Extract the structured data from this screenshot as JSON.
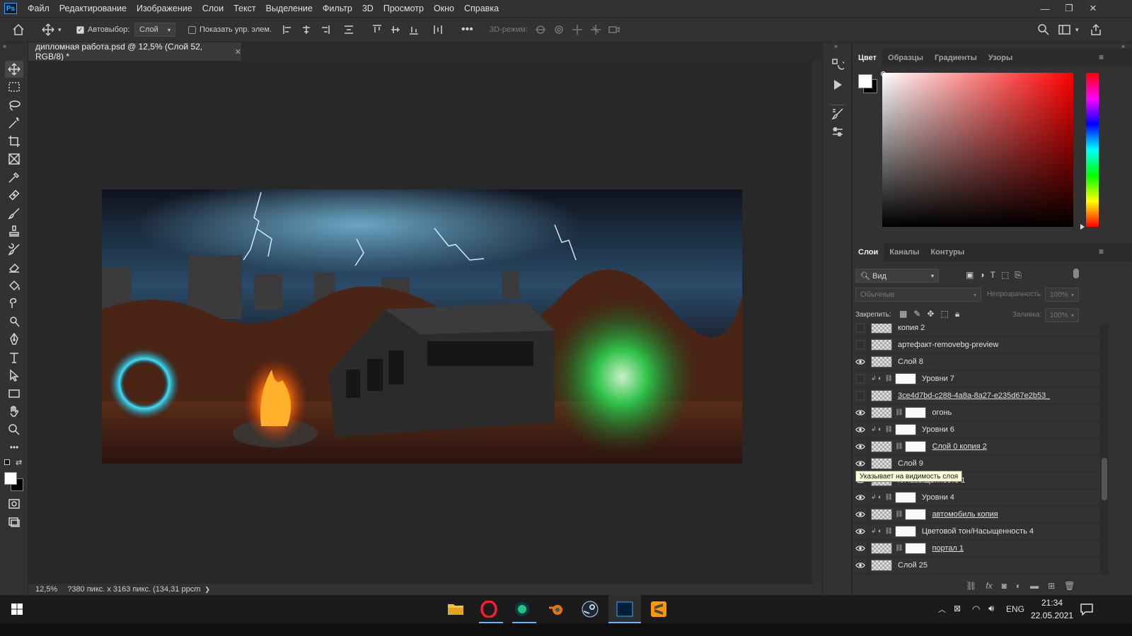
{
  "menubar": {
    "logo": "Ps",
    "items": [
      "Файл",
      "Редактирование",
      "Изображение",
      "Слои",
      "Текст",
      "Выделение",
      "Фильтр",
      "3D",
      "Просмотр",
      "Окно",
      "Справка"
    ]
  },
  "options": {
    "autoselect_label": "Автовыбор:",
    "autoselect_value": "Слой",
    "show_transform": "Показать упр. элем.",
    "mode3d": "3D-режим:"
  },
  "document": {
    "tab_title": "дипломная работа.psd @ 12,5% (Слой 52, RGB/8) *"
  },
  "status": {
    "zoom": "12,5%",
    "dims": "?380 пикс. x 3163 пикс. (134,31 ppcm",
    "arrow": "❯"
  },
  "color_panel": {
    "tabs": [
      "Цвет",
      "Образцы",
      "Градиенты",
      "Узоры"
    ]
  },
  "layers_panel": {
    "tabs": [
      "Слои",
      "Каналы",
      "Контуры"
    ],
    "filter": "Вид",
    "blend": "Обычные",
    "opacity_label": "Непрозрачность:",
    "opacity_value": "100%",
    "lock_label": "Закрепить:",
    "fill_label": "Заливка:",
    "fill_value": "100%",
    "tooltip": "Указывает на видимость слоя",
    "layers": [
      {
        "name": "копия 2",
        "visible": false,
        "adj": false,
        "mask": false,
        "u": false
      },
      {
        "name": "артефакт-removebg-preview",
        "visible": false,
        "adj": false,
        "mask": false,
        "u": false
      },
      {
        "name": "Слой 8",
        "visible": true,
        "adj": false,
        "mask": false,
        "u": false
      },
      {
        "name": "Уровни 7",
        "visible": false,
        "adj": true,
        "mask": true,
        "u": false
      },
      {
        "name": "3ce4d7bd-c288-4a8a-8a27-e235d67e2b53_",
        "visible": false,
        "adj": false,
        "mask": false,
        "u": true
      },
      {
        "name": "огонь",
        "visible": true,
        "adj": false,
        "mask": true,
        "u": false
      },
      {
        "name": "Уровни 6",
        "visible": true,
        "adj": true,
        "mask": true,
        "u": false
      },
      {
        "name": "Слой 0 копия 2",
        "visible": true,
        "adj": false,
        "mask": true,
        "u": true
      },
      {
        "name": "Слой 9",
        "visible": true,
        "adj": false,
        "mask": false,
        "u": false
      },
      {
        "name": "н/Насыщенность 1",
        "visible": true,
        "adj": false,
        "mask": false,
        "u": false
      },
      {
        "name": "Уровни 4",
        "visible": true,
        "adj": true,
        "mask": true,
        "u": false
      },
      {
        "name": "автомобиль копия",
        "visible": true,
        "adj": false,
        "mask": true,
        "u": true
      },
      {
        "name": "Цветовой тон/Насыщенность 4",
        "visible": true,
        "adj": true,
        "mask": true,
        "u": false
      },
      {
        "name": "портал 1",
        "visible": true,
        "adj": false,
        "mask": true,
        "u": true
      },
      {
        "name": "Слой 25",
        "visible": true,
        "adj": false,
        "mask": false,
        "u": false
      },
      {
        "name": "...",
        "visible": true,
        "adj": false,
        "mask": true,
        "u": false
      }
    ],
    "footer_icons": [
      "link-icon",
      "fx-icon",
      "mask-icon",
      "adjustment-icon",
      "group-icon",
      "new-layer-icon",
      "trash-icon"
    ]
  },
  "taskbar": {
    "lang": "ENG",
    "time": "21:34",
    "date": "22.05.2021"
  }
}
